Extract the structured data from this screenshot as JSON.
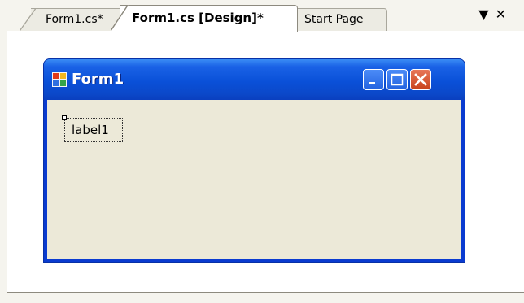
{
  "tabs": [
    {
      "label": "Form1.cs*"
    },
    {
      "label": "Form1.cs [Design]*"
    },
    {
      "label": "Start Page"
    }
  ],
  "tab_controls": {
    "dropdown_icon": "chevron-down-icon",
    "close_icon": "close-icon",
    "dropdown": "▼",
    "close": "✕"
  },
  "form": {
    "title": "Form1",
    "icon": "form-app-icon",
    "buttons": {
      "minimize": "minimize-icon",
      "maximize": "maximize-icon",
      "close": "close-icon"
    },
    "label": "label1"
  },
  "colors": {
    "titlebar": "#0a50d8",
    "client": "#ece9d8",
    "close_button": "#c8421b"
  }
}
